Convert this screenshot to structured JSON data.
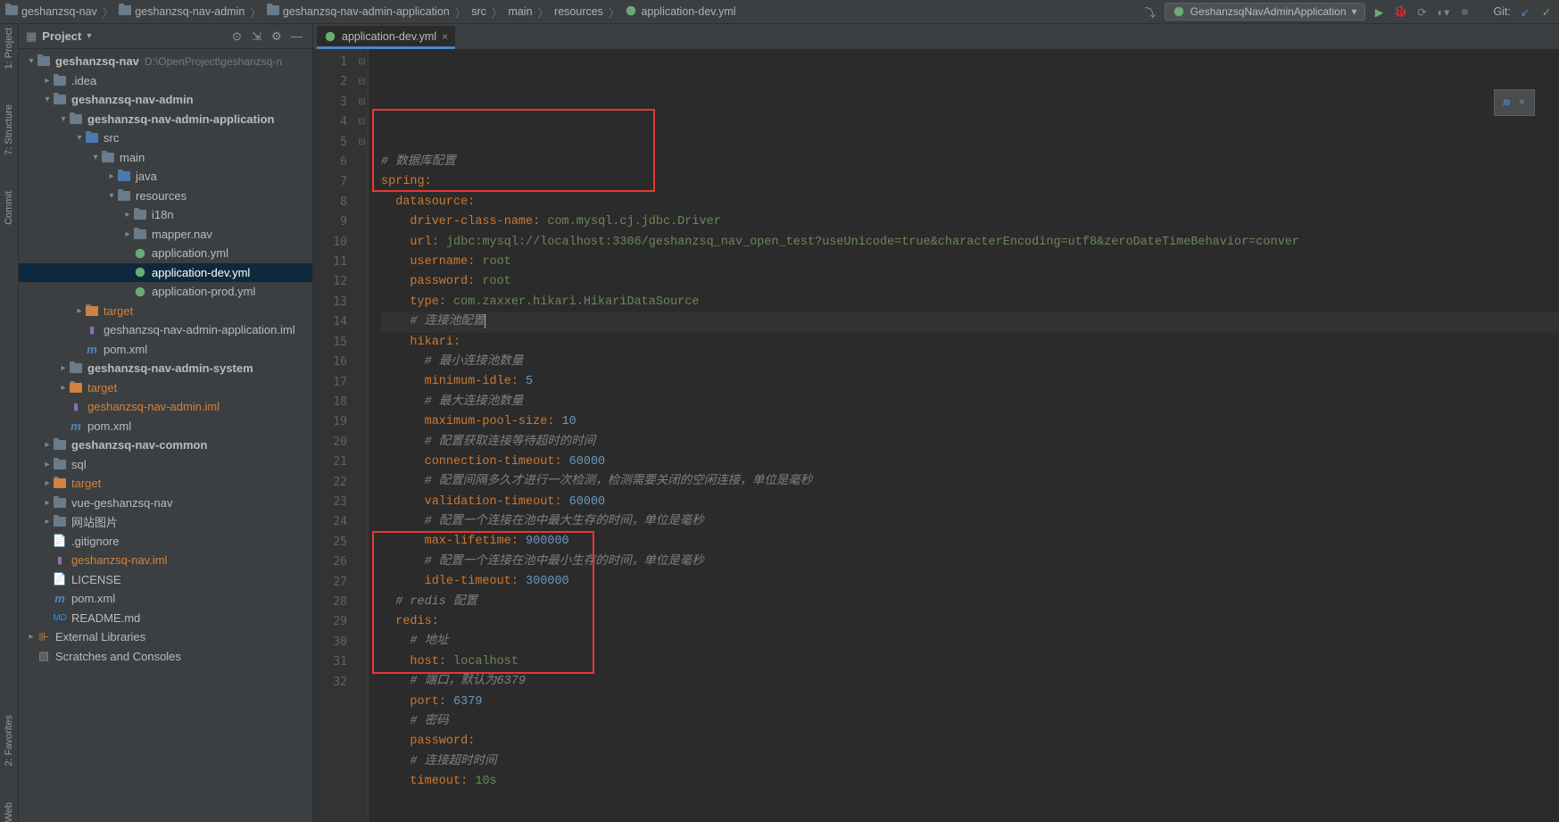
{
  "breadcrumb": [
    {
      "label": "geshanzsq-nav",
      "type": "folder"
    },
    {
      "label": "geshanzsq-nav-admin",
      "type": "folder"
    },
    {
      "label": "geshanzsq-nav-admin-application",
      "type": "folder"
    },
    {
      "label": "src",
      "type": "plain"
    },
    {
      "label": "main",
      "type": "plain"
    },
    {
      "label": "resources",
      "type": "plain"
    },
    {
      "label": "application-dev.yml",
      "type": "yml"
    }
  ],
  "runConfig": "GeshanzsqNavAdminApplication",
  "gitLabel": "Git:",
  "projectPanel": {
    "title": "Project",
    "root": {
      "label": "geshanzsq-nav",
      "path": "D:\\OpenProject\\geshanzsq-n"
    }
  },
  "tree": [
    {
      "depth": 0,
      "arrow": "▾",
      "icon": "folder-dir",
      "label": "geshanzsq-nav",
      "extra": "D:\\OpenProject\\geshanzsq-n",
      "bold": true
    },
    {
      "depth": 1,
      "arrow": "▸",
      "icon": "folder-dir",
      "label": ".idea"
    },
    {
      "depth": 1,
      "arrow": "▾",
      "icon": "folder-dir",
      "label": "geshanzsq-nav-admin",
      "bold": true
    },
    {
      "depth": 2,
      "arrow": "▾",
      "icon": "folder-dir",
      "label": "geshanzsq-nav-admin-application",
      "bold": true
    },
    {
      "depth": 3,
      "arrow": "▾",
      "icon": "folder-blue",
      "label": "src"
    },
    {
      "depth": 4,
      "arrow": "▾",
      "icon": "folder-dir",
      "label": "main"
    },
    {
      "depth": 5,
      "arrow": "▸",
      "icon": "folder-blue",
      "label": "java"
    },
    {
      "depth": 5,
      "arrow": "▾",
      "icon": "folder-dir",
      "label": "resources"
    },
    {
      "depth": 6,
      "arrow": "▸",
      "icon": "folder-dir",
      "label": "i18n"
    },
    {
      "depth": 6,
      "arrow": "▸",
      "icon": "folder-dir",
      "label": "mapper.nav"
    },
    {
      "depth": 6,
      "arrow": "",
      "icon": "yml",
      "label": "application.yml"
    },
    {
      "depth": 6,
      "arrow": "",
      "icon": "yml",
      "label": "application-dev.yml",
      "selected": true
    },
    {
      "depth": 6,
      "arrow": "",
      "icon": "yml",
      "label": "application-prod.yml"
    },
    {
      "depth": 3,
      "arrow": "▸",
      "icon": "folder-orange",
      "label": "target",
      "orange": true
    },
    {
      "depth": 3,
      "arrow": "",
      "icon": "iml",
      "label": "geshanzsq-nav-admin-application.iml"
    },
    {
      "depth": 3,
      "arrow": "",
      "icon": "maven",
      "label": "pom.xml"
    },
    {
      "depth": 2,
      "arrow": "▸",
      "icon": "folder-dir",
      "label": "geshanzsq-nav-admin-system",
      "bold": true
    },
    {
      "depth": 2,
      "arrow": "▸",
      "icon": "folder-orange",
      "label": "target",
      "orange": true
    },
    {
      "depth": 2,
      "arrow": "",
      "icon": "iml",
      "label": "geshanzsq-nav-admin.iml",
      "orange": true
    },
    {
      "depth": 2,
      "arrow": "",
      "icon": "maven",
      "label": "pom.xml"
    },
    {
      "depth": 1,
      "arrow": "▸",
      "icon": "folder-dir",
      "label": "geshanzsq-nav-common",
      "bold": true
    },
    {
      "depth": 1,
      "arrow": "▸",
      "icon": "folder-dir",
      "label": "sql"
    },
    {
      "depth": 1,
      "arrow": "▸",
      "icon": "folder-orange",
      "label": "target",
      "orange": true
    },
    {
      "depth": 1,
      "arrow": "▸",
      "icon": "folder-dir",
      "label": "vue-geshanzsq-nav"
    },
    {
      "depth": 1,
      "arrow": "▸",
      "icon": "folder-dir",
      "label": "网站图片"
    },
    {
      "depth": 1,
      "arrow": "",
      "icon": "file",
      "label": ".gitignore"
    },
    {
      "depth": 1,
      "arrow": "",
      "icon": "iml",
      "label": "geshanzsq-nav.iml",
      "orange": true
    },
    {
      "depth": 1,
      "arrow": "",
      "icon": "file",
      "label": "LICENSE"
    },
    {
      "depth": 1,
      "arrow": "",
      "icon": "maven",
      "label": "pom.xml"
    },
    {
      "depth": 1,
      "arrow": "",
      "icon": "md",
      "label": "README.md"
    },
    {
      "depth": 0,
      "arrow": "▸",
      "icon": "lib",
      "label": "External Libraries"
    },
    {
      "depth": 0,
      "arrow": "",
      "icon": "scratch",
      "label": "Scratches and Consoles"
    }
  ],
  "tab": {
    "label": "application-dev.yml"
  },
  "code": {
    "lines": [
      {
        "n": 1,
        "t": "comment",
        "text": "# 数据库配置",
        "indent": 0
      },
      {
        "n": 2,
        "t": "key",
        "key": "spring",
        "indent": 0
      },
      {
        "n": 3,
        "t": "key",
        "key": "datasource",
        "indent": 2
      },
      {
        "n": 4,
        "t": "kv",
        "key": "driver-class-name",
        "val": "com.mysql.cj.jdbc.Driver",
        "vtype": "str",
        "indent": 4
      },
      {
        "n": 5,
        "t": "kv",
        "key": "url",
        "val": "jdbc:mysql://localhost:3306/geshanzsq_nav_open_test?useUnicode=true&characterEncoding=utf8&zeroDateTimeBehavior=conver",
        "vtype": "str",
        "indent": 4
      },
      {
        "n": 6,
        "t": "kv",
        "key": "username",
        "val": "root",
        "vtype": "str",
        "indent": 4
      },
      {
        "n": 7,
        "t": "kv",
        "key": "password",
        "val": "root",
        "vtype": "str",
        "indent": 4
      },
      {
        "n": 8,
        "t": "kv",
        "key": "type",
        "val": "com.zaxxer.hikari.HikariDataSource",
        "vtype": "str",
        "indent": 4
      },
      {
        "n": 9,
        "t": "comment",
        "text": "# 连接池配置",
        "indent": 4,
        "caret": true,
        "current": true
      },
      {
        "n": 10,
        "t": "key",
        "key": "hikari",
        "indent": 4
      },
      {
        "n": 11,
        "t": "comment",
        "text": "# 最小连接池数量",
        "indent": 6
      },
      {
        "n": 12,
        "t": "kv",
        "key": "minimum-idle",
        "val": "5",
        "vtype": "num",
        "indent": 6
      },
      {
        "n": 13,
        "t": "comment",
        "text": "# 最大连接池数量",
        "indent": 6
      },
      {
        "n": 14,
        "t": "kv",
        "key": "maximum-pool-size",
        "val": "10",
        "vtype": "num",
        "indent": 6
      },
      {
        "n": 15,
        "t": "comment",
        "text": "# 配置获取连接等待超时的时间",
        "indent": 6
      },
      {
        "n": 16,
        "t": "kv",
        "key": "connection-timeout",
        "val": "60000",
        "vtype": "num",
        "indent": 6
      },
      {
        "n": 17,
        "t": "comment",
        "text": "# 配置间隔多久才进行一次检测，检测需要关闭的空闲连接，单位是毫秒",
        "indent": 6
      },
      {
        "n": 18,
        "t": "kv",
        "key": "validation-timeout",
        "val": "60000",
        "vtype": "num",
        "indent": 6
      },
      {
        "n": 19,
        "t": "comment",
        "text": "# 配置一个连接在池中最大生存的时间，单位是毫秒",
        "indent": 6
      },
      {
        "n": 20,
        "t": "kv",
        "key": "max-lifetime",
        "val": "900000",
        "vtype": "num",
        "indent": 6
      },
      {
        "n": 21,
        "t": "comment",
        "text": "# 配置一个连接在池中最小生存的时间，单位是毫秒",
        "indent": 6
      },
      {
        "n": 22,
        "t": "kv",
        "key": "idle-timeout",
        "val": "300000",
        "vtype": "num",
        "indent": 6
      },
      {
        "n": 23,
        "t": "comment",
        "text": "# redis 配置",
        "indent": 2
      },
      {
        "n": 24,
        "t": "key",
        "key": "redis",
        "indent": 2
      },
      {
        "n": 25,
        "t": "comment",
        "text": "# 地址",
        "indent": 4
      },
      {
        "n": 26,
        "t": "kv",
        "key": "host",
        "val": "localhost",
        "vtype": "str",
        "indent": 4
      },
      {
        "n": 27,
        "t": "comment",
        "text": "# 端口，默认为6379",
        "indent": 4
      },
      {
        "n": 28,
        "t": "kv",
        "key": "port",
        "val": "6379",
        "vtype": "num",
        "indent": 4
      },
      {
        "n": 29,
        "t": "comment",
        "text": "# 密码",
        "indent": 4
      },
      {
        "n": 30,
        "t": "kv",
        "key": "password",
        "val": "",
        "vtype": "str",
        "indent": 4
      },
      {
        "n": 31,
        "t": "comment",
        "text": "# 连接超时时间",
        "indent": 4
      },
      {
        "n": 32,
        "t": "kv",
        "key": "timeout",
        "val": "10s",
        "vtype": "str",
        "indent": 4
      }
    ]
  },
  "leftRails": [
    {
      "label": "1: Project"
    },
    {
      "label": "7: Structure"
    },
    {
      "label": "Commit"
    }
  ],
  "leftRailsBottom": [
    {
      "label": "2: Favorites"
    },
    {
      "label": "Web"
    }
  ],
  "mybatisBanner": {
    "label": "m"
  }
}
